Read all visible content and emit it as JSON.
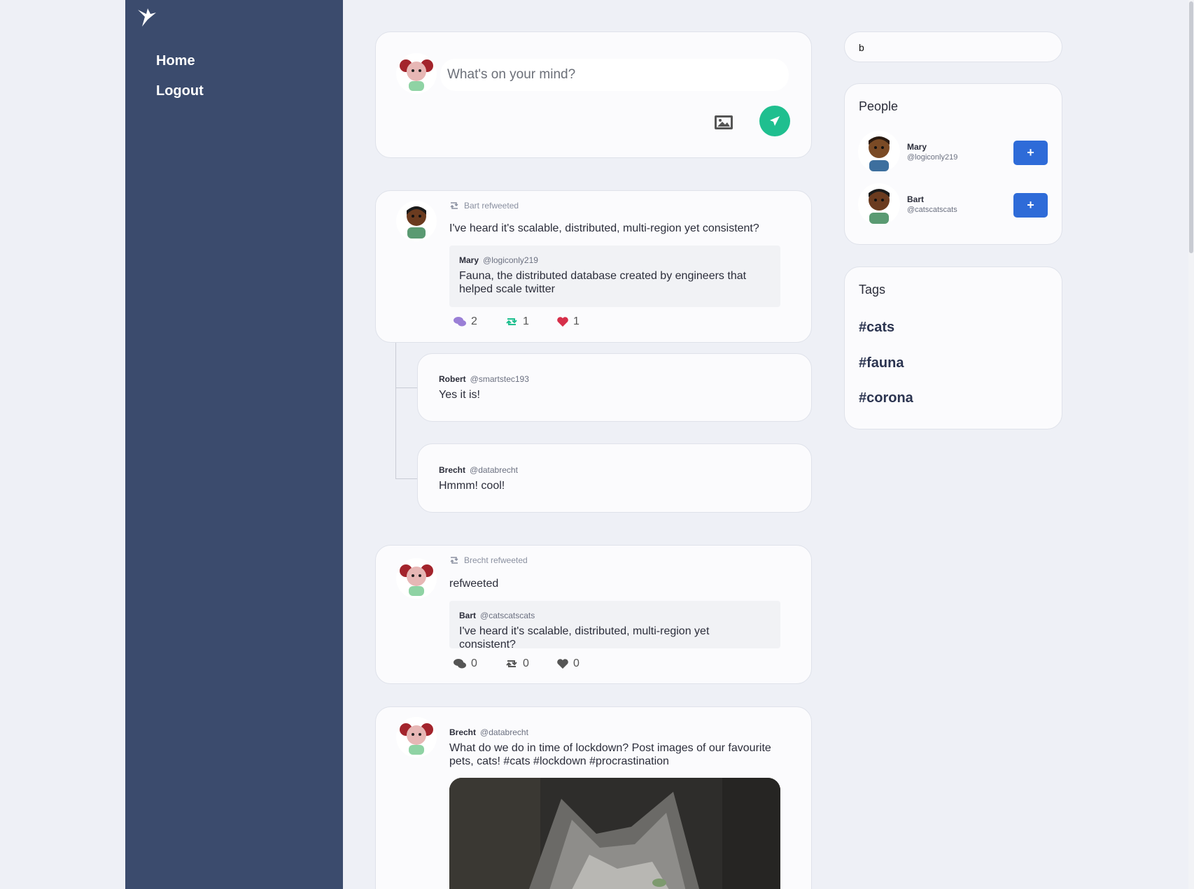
{
  "nav": {
    "home": "Home",
    "logout": "Logout"
  },
  "composer": {
    "placeholder": "What's on your mind?"
  },
  "search": {
    "value": "b"
  },
  "people": {
    "title": "People",
    "items": [
      {
        "name": "Mary",
        "handle": "@logiconly219",
        "action": "+"
      },
      {
        "name": "Bart",
        "handle": "@catscatscats",
        "action": "+"
      }
    ]
  },
  "tags": {
    "title": "Tags",
    "items": [
      "#cats",
      "#fauna",
      "#corona"
    ]
  },
  "feed": [
    {
      "retweet_label": "Bart refweeted",
      "text": "I've heard it's scalable, distributed, multi-region yet consistent?",
      "quote": {
        "name": "Mary",
        "handle": "@logiconly219",
        "text": "Fauna, the distributed database created by engineers that helped scale twitter"
      },
      "comments": "2",
      "refweets": "1",
      "likes": "1"
    },
    {
      "retweet_label": "Brecht refweeted",
      "text": "refweeted",
      "quote": {
        "name": "Bart",
        "handle": "@catscatscats",
        "text": "I've heard it's scalable, distributed, multi-region yet consistent?"
      },
      "comments": "0",
      "refweets": "0",
      "likes": "0"
    },
    {
      "name": "Brecht",
      "handle": "@databrecht",
      "text": "What do we do in time of lockdown? Post images of our favourite pets, cats! #cats #lockdown #procrastination"
    }
  ],
  "replies": [
    {
      "name": "Robert",
      "handle": "@smartstec193",
      "text": "Yes it is!"
    },
    {
      "name": "Brecht",
      "handle": "@databrecht",
      "text": "Hmmm! cool!"
    }
  ],
  "colors": {
    "sidebar": "#3b4b6d",
    "accent_green": "#1fbf8f",
    "button_blue": "#2e6bd8",
    "like_red": "#d62f4a",
    "comment_purple": "#9a7fd6"
  }
}
